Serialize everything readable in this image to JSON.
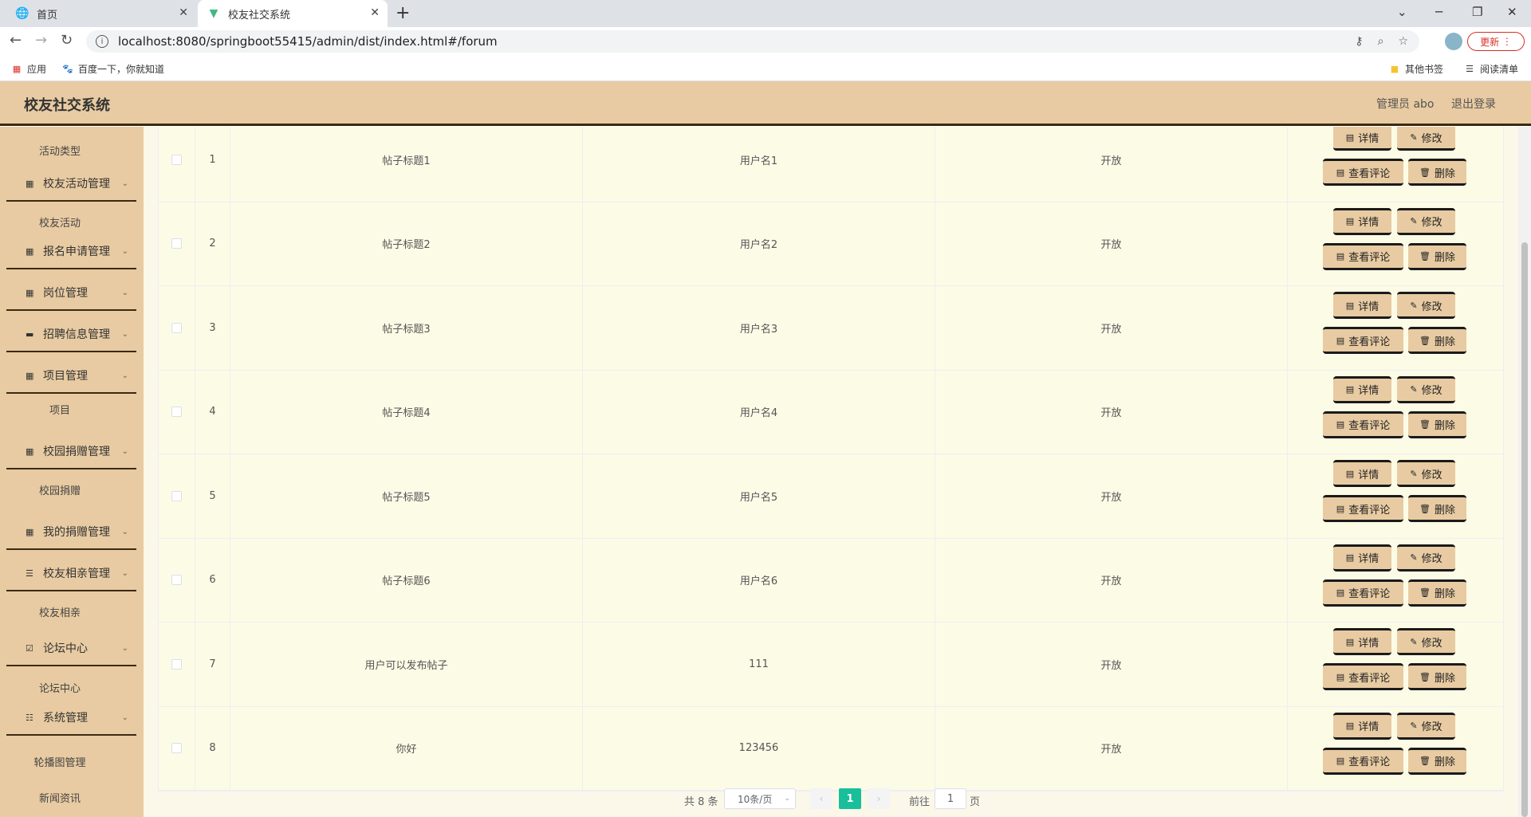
{
  "browser": {
    "tabs": [
      {
        "title": "首页",
        "icon": "globe-icon"
      },
      {
        "title": "校友社交系统",
        "icon": "vue-logo-icon"
      }
    ],
    "url": "localhost:8080/springboot55415/admin/dist/index.html#/forum",
    "update_label": "更新",
    "bookmarks": {
      "apps": "应用",
      "baidu": "百度一下，你就知道",
      "other": "其他书签",
      "reading": "阅读清单"
    }
  },
  "header": {
    "title": "校友社交系统",
    "user": "管理员 abo",
    "logout": "退出登录"
  },
  "sidebar": {
    "items": [
      {
        "type": "sub",
        "label": "活动类型"
      },
      {
        "type": "group",
        "label": "校友活动管理",
        "icon": "grid-icon"
      },
      {
        "type": "sub",
        "label": "校友活动"
      },
      {
        "type": "group",
        "label": "报名申请管理",
        "icon": "grid-icon"
      },
      {
        "type": "group",
        "label": "岗位管理",
        "icon": "grid-icon"
      },
      {
        "type": "group",
        "label": "招聘信息管理",
        "icon": "monitor-icon"
      },
      {
        "type": "group",
        "label": "项目管理",
        "icon": "grid-icon"
      },
      {
        "type": "sub",
        "label": "项目"
      },
      {
        "type": "group",
        "label": "校园捐赠管理",
        "icon": "grid-icon"
      },
      {
        "type": "sub",
        "label": "校园捐赠"
      },
      {
        "type": "group",
        "label": "我的捐赠管理",
        "icon": "grid-icon"
      },
      {
        "type": "group",
        "label": "校友相亲管理",
        "icon": "menu-icon"
      },
      {
        "type": "sub",
        "label": "校友相亲"
      },
      {
        "type": "group",
        "label": "论坛中心",
        "icon": "checkbox-icon"
      },
      {
        "type": "sub",
        "label": "论坛中心"
      },
      {
        "type": "group",
        "label": "系统管理",
        "icon": "sliders-icon"
      },
      {
        "type": "sub",
        "label": "轮播图管理"
      },
      {
        "type": "sub",
        "label": "新闻资讯"
      }
    ]
  },
  "table": {
    "buttons": {
      "detail": "详情",
      "edit": "修改",
      "comments": "查看评论",
      "delete": "删除"
    },
    "rows": [
      {
        "index": "1",
        "title": "帖子标题1",
        "user": "用户名1",
        "status": "开放"
      },
      {
        "index": "2",
        "title": "帖子标题2",
        "user": "用户名2",
        "status": "开放"
      },
      {
        "index": "3",
        "title": "帖子标题3",
        "user": "用户名3",
        "status": "开放"
      },
      {
        "index": "4",
        "title": "帖子标题4",
        "user": "用户名4",
        "status": "开放"
      },
      {
        "index": "5",
        "title": "帖子标题5",
        "user": "用户名5",
        "status": "开放"
      },
      {
        "index": "6",
        "title": "帖子标题6",
        "user": "用户名6",
        "status": "开放"
      },
      {
        "index": "7",
        "title": "用户可以发布帖子",
        "user": "111",
        "status": "开放"
      },
      {
        "index": "8",
        "title": "你好",
        "user": "123456",
        "status": "开放"
      }
    ]
  },
  "pagination": {
    "total": "共 8 条",
    "page_size": "10条/页",
    "current": "1",
    "goto": "前往",
    "goto_value": "1",
    "page_suffix": "页"
  },
  "colors": {
    "accent": "#e8cba2",
    "sidebar_border": "#3b2a12",
    "page_active": "#19be9b",
    "content_bg": "#fcfbe6"
  }
}
